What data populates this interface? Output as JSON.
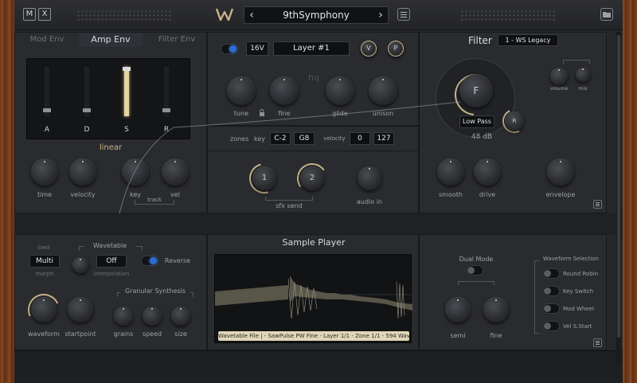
{
  "header": {
    "m_label": "M",
    "x_label": "X",
    "preset_name": "9thSymphony",
    "prev_arrow": "‹",
    "next_arrow": "›"
  },
  "env": {
    "tabs": [
      "Mod Env",
      "Amp Env",
      "Filter Env"
    ],
    "sliders": [
      "A",
      "D",
      "S",
      "R"
    ],
    "curve": "linear",
    "knobs": [
      "time",
      "velocity",
      "key",
      "vel"
    ],
    "track_label": "track"
  },
  "layer": {
    "voltage": "16V",
    "name": "Layer #1",
    "v_btn": "V",
    "p_btn": "P",
    "hq": "hq",
    "knobs": [
      "tune",
      "fine",
      "glide",
      "unison"
    ]
  },
  "zones": {
    "label": "zones",
    "key_label": "key",
    "key_low": "C-2",
    "key_high": "G8",
    "velocity_label": "velocity",
    "vel_low": "0",
    "vel_high": "127",
    "sfx1": "1",
    "sfx2": "2",
    "sfx_send": "sfx send",
    "audio_in": "audio in"
  },
  "filter": {
    "title": "Filter",
    "type": "1 - WS Legacy",
    "f_label": "F",
    "r_label": "R",
    "mode": "Low Pass",
    "slope": "48 dB",
    "volume": "volume",
    "mix": "mix",
    "knobs": [
      "smooth",
      "drive",
      "envelope"
    ]
  },
  "wavetable": {
    "bwd": "bwd",
    "mode": "Multi",
    "morph": "morph",
    "title": "Wavetable",
    "interp_value": "Off",
    "interpolation": "interpolation",
    "reverse": "Reverse",
    "knobs": [
      "waveform",
      "startpoint"
    ],
    "granular_title": "Granular Synthesis",
    "granular_knobs": [
      "grains",
      "speed",
      "size"
    ]
  },
  "sample_player": {
    "title": "Sample Player",
    "file_info": "Wavetable File | - SawPulse PW Fine - Layer 1/1 - Zone 1/1 - 594 Waves"
  },
  "dual_mode": {
    "label": "Dual Mode",
    "knobs": [
      "semi",
      "fine"
    ],
    "waveform_selection": "Waveform Selection",
    "options": [
      "Round Robin",
      "Key Switch",
      "Mod Wheel",
      "Vel S.Start"
    ]
  },
  "colors": {
    "accent_gold": "#c9b48a",
    "toggle_blue": "#2a6fd0",
    "wave_fill": "#6a6656"
  }
}
